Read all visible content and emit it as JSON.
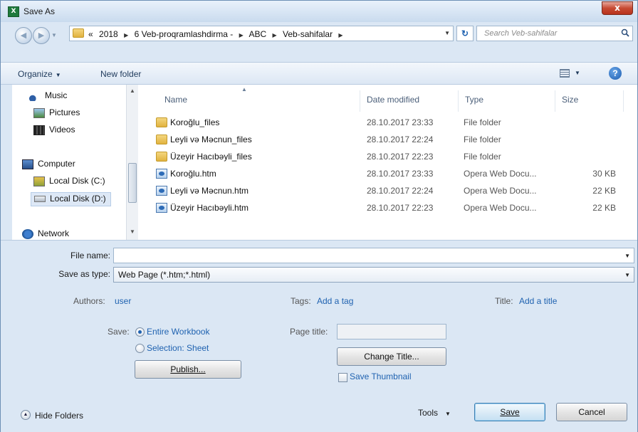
{
  "window": {
    "title": "Save As",
    "close_glyph": "x",
    "app_icon_glyph": "X"
  },
  "address": {
    "prefix": "«",
    "crumbs": [
      "2018",
      "6 Veb-proqramlashdirma -",
      "ABC",
      "Veb-sahifalar"
    ],
    "search_placeholder": "Search Veb-sahifalar"
  },
  "toolbar": {
    "organize": "Organize",
    "new_folder": "New folder",
    "help": "?"
  },
  "nav": {
    "items": [
      {
        "label": "Music",
        "icon": "music-icon"
      },
      {
        "label": "Pictures",
        "icon": "pictures-icon"
      },
      {
        "label": "Videos",
        "icon": "videos-icon"
      },
      {
        "label": "Computer",
        "icon": "computer-icon"
      },
      {
        "label": "Local Disk (C:)",
        "icon": "drive-icon"
      },
      {
        "label": "Local Disk (D:)",
        "icon": "drive-icon"
      },
      {
        "label": "Network",
        "icon": "network-icon"
      }
    ]
  },
  "files": {
    "columns": [
      "Name",
      "Date modified",
      "Type",
      "Size"
    ],
    "rows": [
      {
        "name": "Koroğlu_files",
        "date": "28.10.2017 23:33",
        "type": "File folder",
        "size": "",
        "icon": "folder-icon"
      },
      {
        "name": "Leyli və Məcnun_files",
        "date": "28.10.2017 22:24",
        "type": "File folder",
        "size": "",
        "icon": "folder-icon"
      },
      {
        "name": "Üzeyir Hacıbəyli_files",
        "date": "28.10.2017 22:23",
        "type": "File folder",
        "size": "",
        "icon": "folder-icon"
      },
      {
        "name": "Koroğlu.htm",
        "date": "28.10.2017 23:33",
        "type": "Opera Web Docu...",
        "size": "30 KB",
        "icon": "web-document-icon"
      },
      {
        "name": "Leyli və Məcnun.htm",
        "date": "28.10.2017 22:24",
        "type": "Opera Web Docu...",
        "size": "22 KB",
        "icon": "web-document-icon"
      },
      {
        "name": "Üzeyir Hacıbəyli.htm",
        "date": "28.10.2017 22:23",
        "type": "Opera Web Docu...",
        "size": "22 KB",
        "icon": "web-document-icon"
      }
    ]
  },
  "form": {
    "file_name_label": "File name:",
    "file_name_value": "",
    "save_as_type_label": "Save as type:",
    "save_as_type_value": "Web Page (*.htm;*.html)",
    "authors_label": "Authors:",
    "authors_value": "user",
    "tags_label": "Tags:",
    "tags_value": "Add a tag",
    "title_label": "Title:",
    "title_value": "Add a title",
    "save_label": "Save:",
    "entire_workbook": "Entire Workbook",
    "selection_sheet": "Selection: Sheet",
    "publish": "Publish...",
    "page_title_label": "Page title:",
    "change_title": "Change Title...",
    "save_thumbnail": "Save Thumbnail"
  },
  "footer": {
    "hide_folders": "Hide Folders",
    "tools": "Tools",
    "save": "Save",
    "cancel": "Cancel"
  }
}
